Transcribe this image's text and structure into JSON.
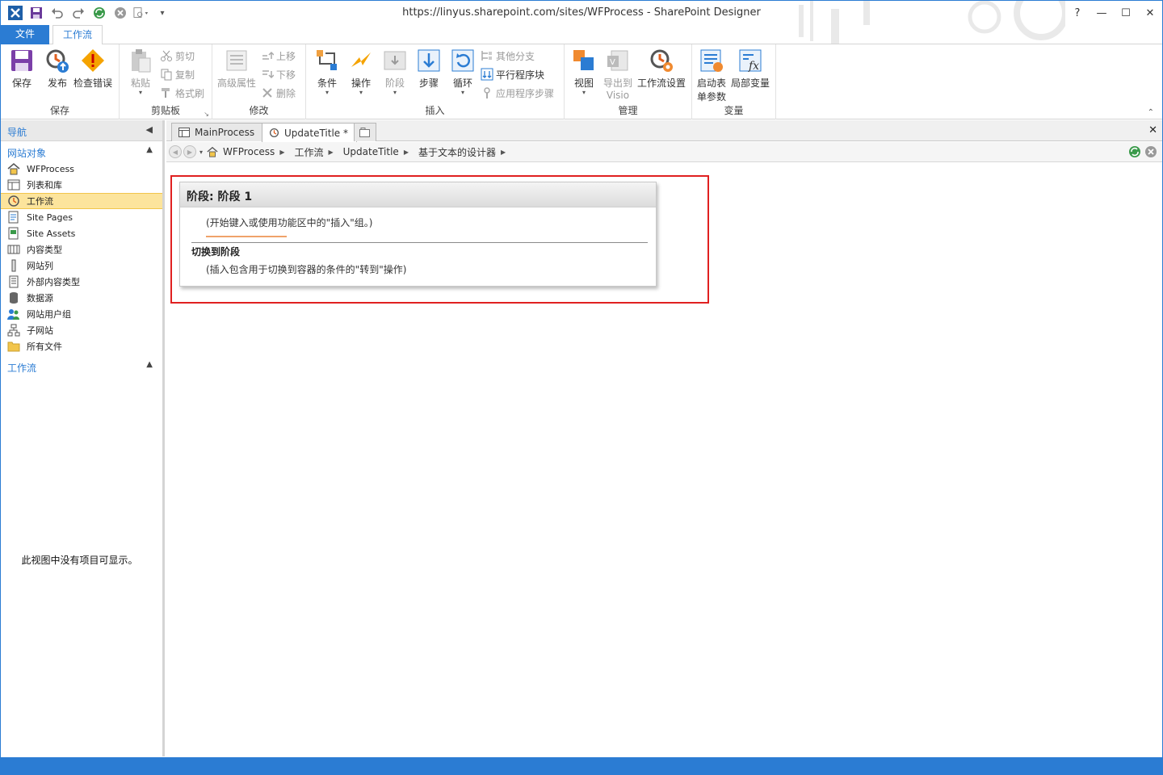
{
  "window": {
    "title": "https://linyus.sharepoint.com/sites/WFProcess - SharePoint Designer",
    "help": "?",
    "minimize": "—",
    "maximize": "☐",
    "close": "✕"
  },
  "ribbon_tabs": {
    "file": "文件",
    "workflow": "工作流"
  },
  "ribbon": {
    "save_group": {
      "label": "保存",
      "save": "保存",
      "publish": "发布",
      "check": "检查错误"
    },
    "clipboard_group": {
      "label": "剪贴板",
      "paste": "粘贴",
      "cut": "剪切",
      "copy": "复制",
      "format_painter": "格式刷"
    },
    "modify_group": {
      "label": "修改",
      "advanced": "高级属性",
      "move_up": "上移",
      "move_down": "下移",
      "delete": "删除"
    },
    "insert_group": {
      "label": "插入",
      "condition": "条件",
      "action": "操作",
      "stage": "阶段",
      "step": "步骤",
      "loop": "循环",
      "else_branch": "其他分支",
      "parallel_block": "平行程序块",
      "app_step": "应用程序步骤"
    },
    "manage_group": {
      "label": "管理",
      "views": "视图",
      "export_line1": "导出到",
      "export_line2": "Visio",
      "settings": "工作流设置"
    },
    "variables_group": {
      "label": "变量",
      "init_line1": "启动表",
      "init_line2": "单参数",
      "local_vars": "局部变量"
    }
  },
  "nav": {
    "header": "导航",
    "site_objects": "网站对象",
    "items": [
      {
        "label": "WFProcess",
        "icon": "home-icon"
      },
      {
        "label": "列表和库",
        "icon": "list-icon"
      },
      {
        "label": "工作流",
        "icon": "workflow-icon",
        "selected": true
      },
      {
        "label": "Site Pages",
        "icon": "pages-icon"
      },
      {
        "label": "Site Assets",
        "icon": "assets-icon"
      },
      {
        "label": "内容类型",
        "icon": "content-type-icon"
      },
      {
        "label": "网站列",
        "icon": "column-icon"
      },
      {
        "label": "外部内容类型",
        "icon": "external-content-icon"
      },
      {
        "label": "数据源",
        "icon": "database-icon"
      },
      {
        "label": "网站用户组",
        "icon": "users-icon"
      },
      {
        "label": "子网站",
        "icon": "subsite-icon"
      },
      {
        "label": "所有文件",
        "icon": "folder-icon"
      }
    ],
    "workflows_section": "工作流",
    "empty_message": "此视图中没有项目可显示。"
  },
  "doc_tabs": [
    {
      "label": "MainProcess"
    },
    {
      "label": "UpdateTitle *"
    }
  ],
  "breadcrumb": [
    "WFProcess",
    "工作流",
    "UpdateTitle",
    "基于文本的设计器"
  ],
  "stage": {
    "title": "阶段: 阶段 1",
    "hint": "(开始键入或使用功能区中的\"插入\"组。)",
    "transition_label": "切换到阶段",
    "transition_hint": "(插入包含用于切换到容器的条件的\"转到\"操作)"
  },
  "colors": {
    "accent": "#2b7cd3",
    "highlight_border": "#e02020",
    "selected_item": "#fce49c"
  }
}
